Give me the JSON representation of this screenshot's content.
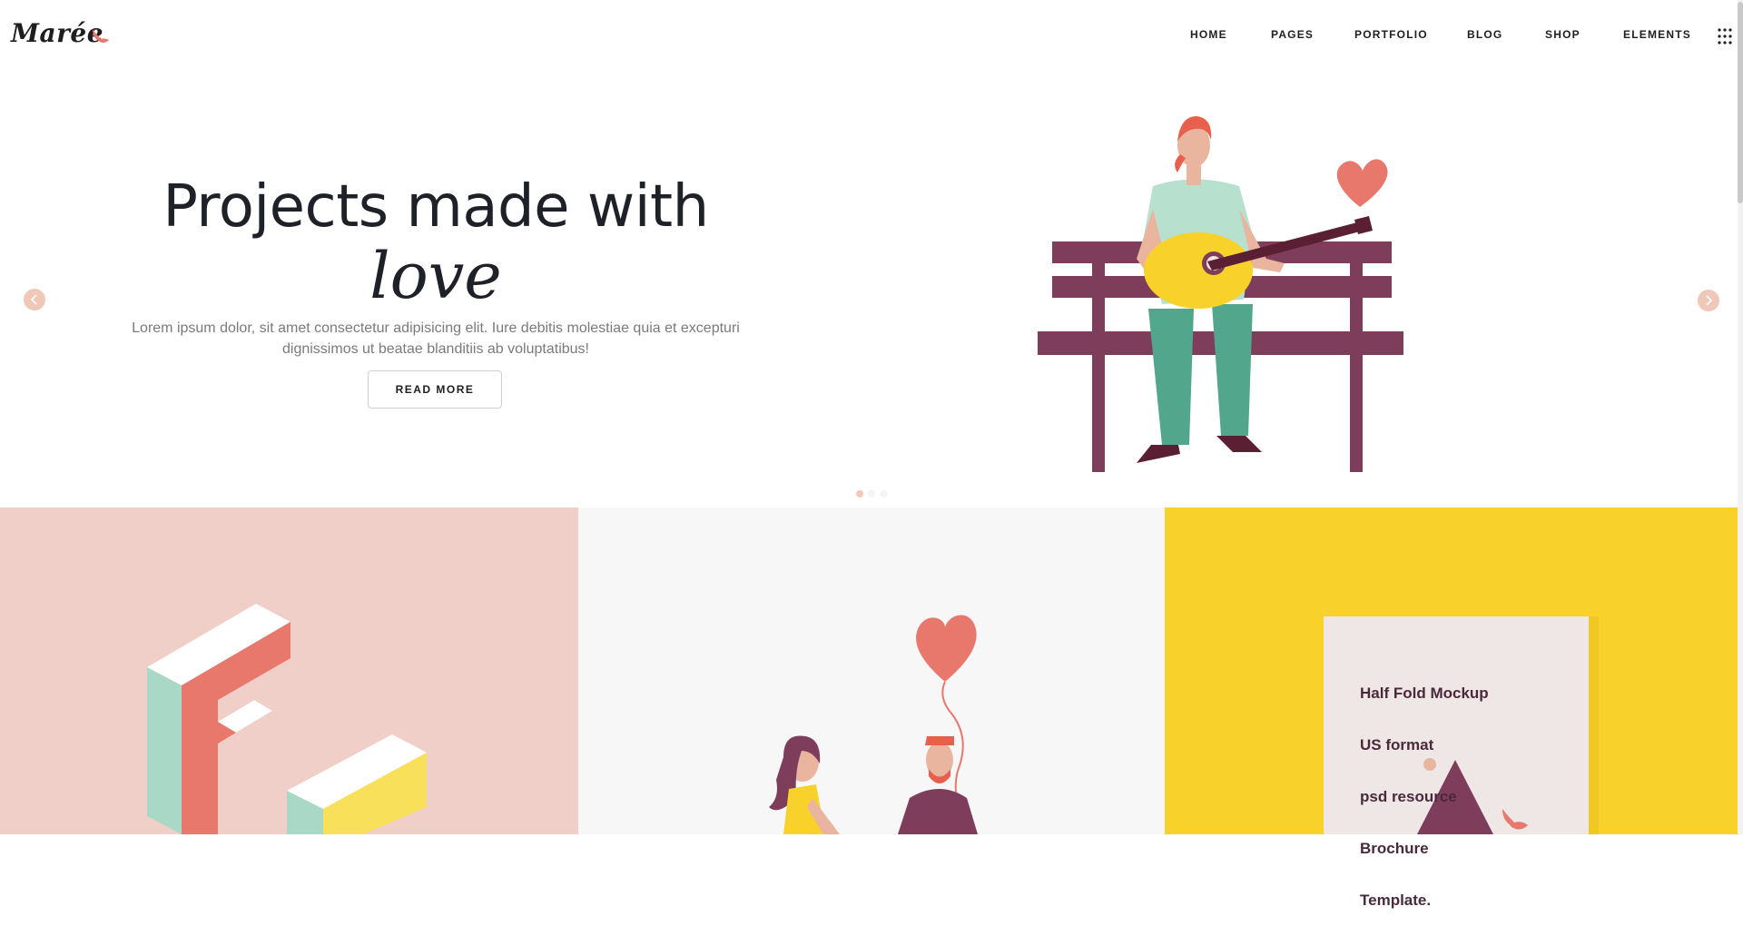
{
  "brand": {
    "name": "Marée",
    "accent": "#e8776c",
    "text_color": "#1f2128"
  },
  "nav": {
    "items": [
      "HOME",
      "PAGES",
      "PORTFOLIO",
      "BLOG",
      "SHOP",
      "ELEMENTS"
    ],
    "menu_icon": "grid-menu-icon"
  },
  "hero": {
    "title_line1": "Projects made with",
    "title_line2": "love",
    "subtitle_line1": "Lorem ipsum dolor, sit amet consectetur adipisicing elit. Iure debitis molestiae quia et excepturi",
    "subtitle_line2": "dignissimos ut beatae blanditiis ab voluptatibus!",
    "cta_label": "READ MORE",
    "prev_icon": "chevron-left-icon",
    "next_icon": "chevron-right-icon",
    "slide_count": 3,
    "active_slide": 1
  },
  "portfolio": {
    "panels": [
      {
        "name": "letters-panel",
        "bg": "#f1cfc9"
      },
      {
        "name": "couple-panel",
        "bg": "#f7f7f7"
      },
      {
        "name": "mockup-panel",
        "bg": "#f8d12b"
      }
    ],
    "mockup_lines": [
      "Half Fold Mockup",
      "US format",
      "psd resource",
      "Brochure",
      "Template."
    ]
  }
}
